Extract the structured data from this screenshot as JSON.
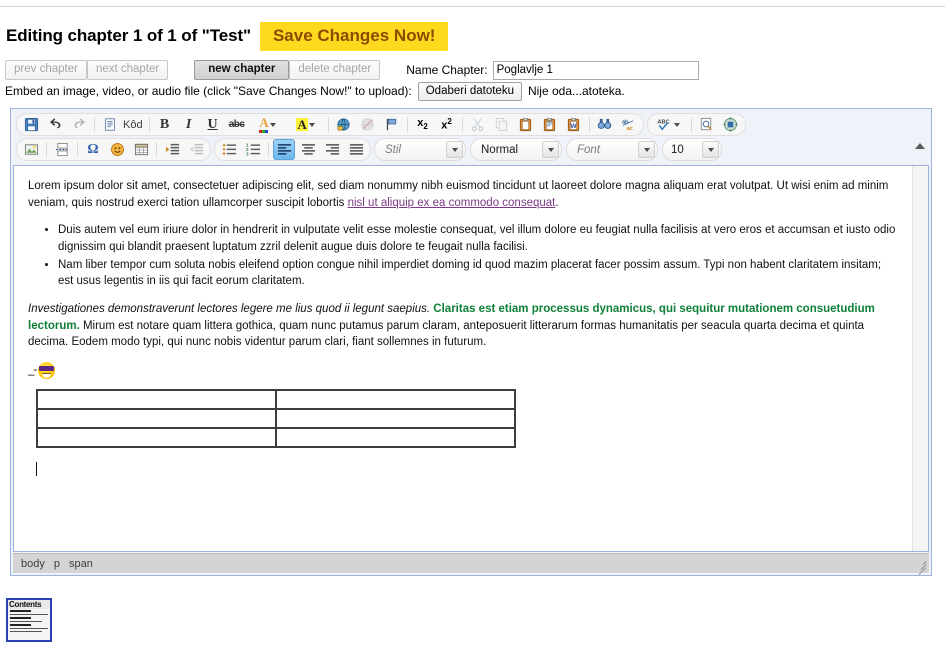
{
  "header": {
    "title": "Editing chapter 1 of 1 of \"Test\"",
    "save_button_label": "Save Changes Now!",
    "accent_yellow": "#ffd91e",
    "accent_brown": "#8c4b00"
  },
  "chapter_toolbar": {
    "prev_label": "prev chapter",
    "next_label": "next chapter",
    "new_label": "new chapter",
    "delete_label": "delete chapter",
    "name_label": "Name Chapter:",
    "name_value": "Poglavlje 1",
    "name_placeholder": ""
  },
  "embed_row": {
    "label": "Embed an image, video, or audio file (click \"Save Changes Now!\" to upload):",
    "file_button_label": "Odaberi datoteku",
    "file_status": "Nije oda...atoteka."
  },
  "editor": {
    "toolbar_row1": [
      {
        "name": "save-icon",
        "glyph": "save",
        "state": "normal"
      },
      {
        "name": "undo-icon",
        "glyph": "undo",
        "state": "normal"
      },
      {
        "name": "redo-icon",
        "glyph": "redo",
        "state": "disabled"
      },
      {
        "name": "source-code-icon",
        "glyph": "source",
        "label": "Kôd",
        "state": "normal"
      },
      {
        "name": "bold-icon",
        "glyph": "B",
        "state": "normal"
      },
      {
        "name": "italic-icon",
        "glyph": "I",
        "state": "normal"
      },
      {
        "name": "underline-icon",
        "glyph": "U",
        "state": "normal"
      },
      {
        "name": "strikethrough-icon",
        "glyph": "abc",
        "state": "normal"
      },
      {
        "name": "text-color-icon",
        "glyph": "A-color",
        "state": "normal"
      },
      {
        "name": "background-color-icon",
        "glyph": "A-highlight",
        "state": "normal"
      },
      {
        "name": "link-icon",
        "glyph": "globe-link",
        "state": "normal"
      },
      {
        "name": "unlink-icon",
        "glyph": "globe-unlink",
        "state": "disabled"
      },
      {
        "name": "anchor-icon",
        "glyph": "flag",
        "state": "normal"
      },
      {
        "name": "subscript-icon",
        "glyph": "x2sub",
        "state": "normal"
      },
      {
        "name": "superscript-icon",
        "glyph": "x2sup",
        "state": "normal"
      },
      {
        "name": "cut-icon",
        "glyph": "scissors",
        "state": "disabled"
      },
      {
        "name": "copy-icon",
        "glyph": "copy",
        "state": "disabled"
      },
      {
        "name": "paste-icon",
        "glyph": "clipboard",
        "state": "normal"
      },
      {
        "name": "paste-as-plain-text-icon",
        "glyph": "clipboard-text",
        "state": "normal"
      },
      {
        "name": "paste-from-word-icon",
        "glyph": "clipboard-word",
        "state": "normal"
      },
      {
        "name": "find-icon",
        "glyph": "binoculars",
        "state": "normal"
      },
      {
        "name": "replace-icon",
        "glyph": "abc-replace",
        "state": "normal"
      },
      {
        "name": "spellcheck-icon",
        "glyph": "abc-check",
        "state": "normal"
      },
      {
        "name": "preview-icon",
        "glyph": "page-magnifier",
        "state": "normal"
      },
      {
        "name": "show-blocks-icon",
        "glyph": "blocks",
        "state": "normal"
      }
    ],
    "toolbar_row2": [
      {
        "name": "image-icon",
        "glyph": "picture",
        "state": "normal"
      },
      {
        "name": "page-break-icon",
        "glyph": "pagebreak",
        "state": "normal"
      },
      {
        "name": "special-character-icon",
        "glyph": "omega",
        "state": "normal"
      },
      {
        "name": "smiley-icon",
        "glyph": "smiley",
        "state": "normal"
      },
      {
        "name": "table-icon",
        "glyph": "table",
        "state": "normal"
      },
      {
        "name": "increase-indent-icon",
        "glyph": "indent",
        "state": "normal"
      },
      {
        "name": "decrease-indent-icon",
        "glyph": "outdent",
        "state": "disabled"
      },
      {
        "name": "bulleted-list-icon",
        "glyph": "ul",
        "state": "normal"
      },
      {
        "name": "numbered-list-icon",
        "glyph": "ol",
        "state": "normal"
      },
      {
        "name": "align-left-icon",
        "glyph": "align-left",
        "state": "active"
      },
      {
        "name": "align-center-icon",
        "glyph": "align-center",
        "state": "normal"
      },
      {
        "name": "align-right-icon",
        "glyph": "align-right",
        "state": "normal"
      },
      {
        "name": "justify-icon",
        "glyph": "justify",
        "state": "normal"
      }
    ],
    "selects": {
      "style": "Stil",
      "format": "Normal",
      "font": "Font",
      "size": "10"
    },
    "element_path": [
      "body",
      "p",
      "span"
    ]
  },
  "document": {
    "paragraph1_a": "Lorem ipsum dolor sit amet, consectetuer adipiscing elit, sed diam nonummy nibh euismod tincidunt ut laoreet dolore magna aliquam erat volutpat. Ut wisi enim ad minim veniam, quis nostrud exerci tation ullamcorper suscipit lobortis ",
    "paragraph1_link": "nisl ut aliquip ex ea commodo consequat",
    "paragraph1_end": ".",
    "bullet1": "Duis autem vel eum iriure dolor in hendrerit in vulputate velit esse molestie consequat, vel illum dolore eu feugiat nulla facilisis at vero eros et accumsan et iusto odio dignissim qui blandit praesent luptatum zzril delenit augue duis dolore te feugait nulla facilisi.",
    "bullet2": "Nam liber tempor cum soluta nobis eleifend option congue nihil imperdiet doming id quod mazim placerat facer possim assum. Typi non habent claritatem insitam; est usus legentis in iis qui facit eorum claritatem.",
    "paragraph2_italic": "Investigationes demonstraverunt lectores legere me lius quod ii legunt saepius.",
    "paragraph2_green": "Claritas est etiam processus dynamicus, qui sequitur mutationem consuetudium lectorum.",
    "paragraph2_rest": "Mirum est notare quam littera gothica, quam nunc putamus parum claram, anteposuerit litterarum formas humanitatis per seacula quarta decima et quinta decima. Eodem modo typi, qui nunc nobis videntur parum clari, fiant sollemnes in futurum.",
    "emoji_text": "_-",
    "emoji_name": "cool-sunglasses-smiley",
    "table": {
      "rows": 3,
      "cols": 2,
      "cells": [
        [
          "",
          ""
        ],
        [
          "",
          ""
        ],
        [
          "",
          ""
        ]
      ]
    },
    "link_color": "#7d3a87",
    "green_color": "#0f8038"
  },
  "contents_thumbnail": {
    "caption": "Contents"
  }
}
